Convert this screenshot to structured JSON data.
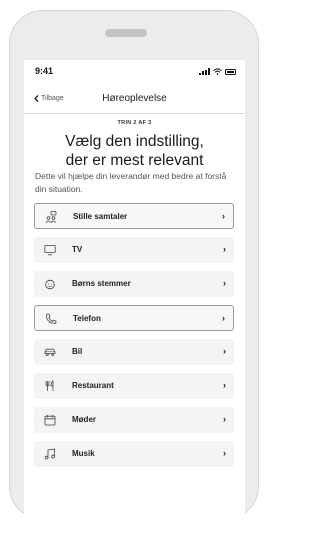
{
  "status_bar": {
    "time": "9:41",
    "icons": [
      "signal-icon",
      "wifi-icon",
      "battery-icon"
    ]
  },
  "nav": {
    "back_label": "Tilbage",
    "title": "Høreoplevelse"
  },
  "step_label": "TRIN 2 AF 3",
  "heading": {
    "line1": "Vælg den indstilling,",
    "line2": "der er mest relevant"
  },
  "description": "Dette vil hjælpe din leverandør med bedre at forstå din situation.",
  "options": [
    {
      "label": "Stille samtaler",
      "icon": "people-icon",
      "selected": true
    },
    {
      "label": "TV",
      "icon": "tv-icon",
      "selected": false
    },
    {
      "label": "Børns stemmer",
      "icon": "child-face-icon",
      "selected": false
    },
    {
      "label": "Telefon",
      "icon": "phone-icon",
      "selected": true
    },
    {
      "label": "Bil",
      "icon": "car-icon",
      "selected": false
    },
    {
      "label": "Restaurant",
      "icon": "cutlery-icon",
      "selected": false
    },
    {
      "label": "Møder",
      "icon": "calendar-icon",
      "selected": false
    },
    {
      "label": "Musik",
      "icon": "music-note-icon",
      "selected": false
    }
  ]
}
